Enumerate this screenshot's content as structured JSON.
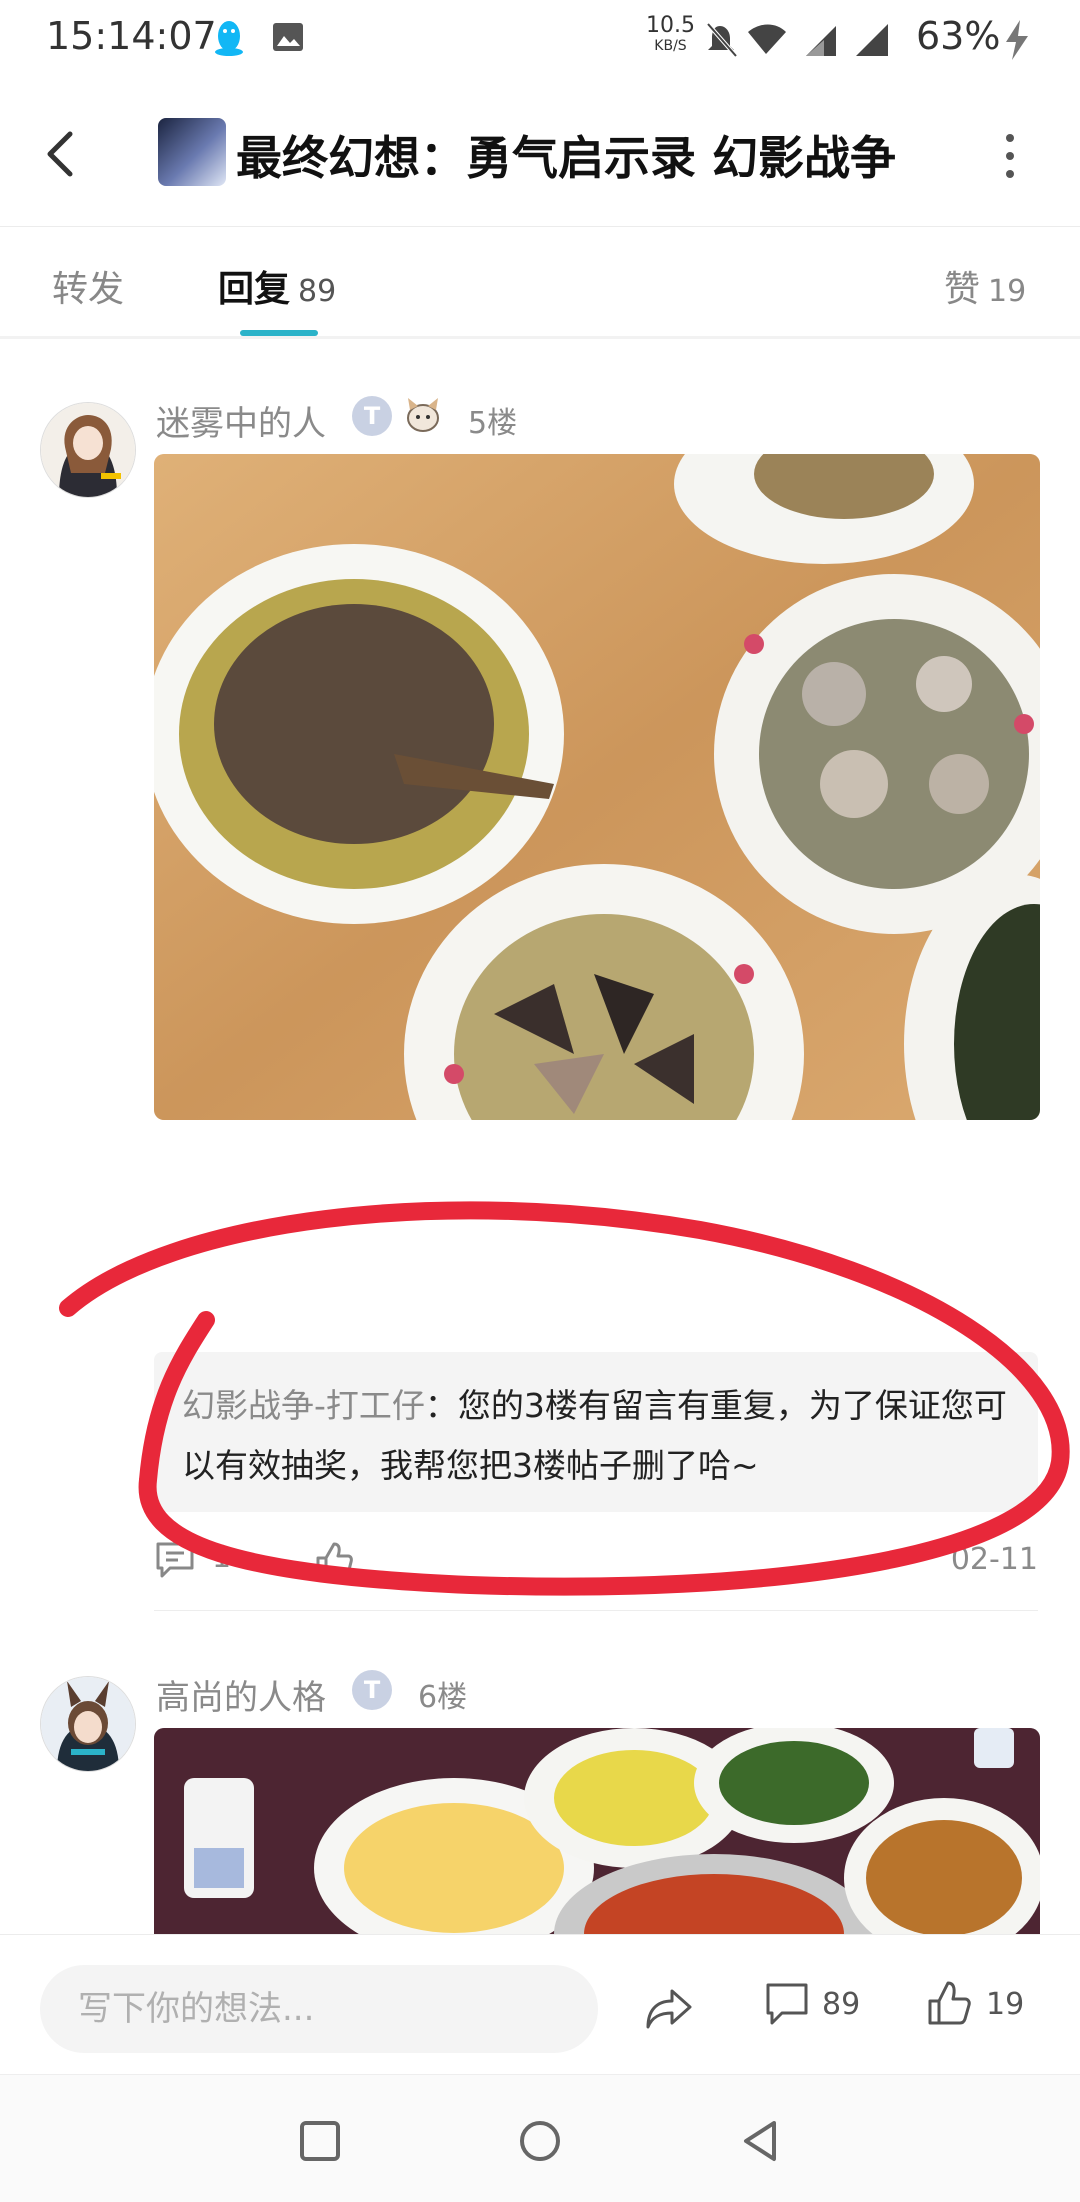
{
  "status_bar": {
    "time": "15:14:07",
    "net_speed": "10.5",
    "net_unit": "KB/S",
    "battery": "63%"
  },
  "header": {
    "title": "最终幻想：勇气启示录 幻影战争"
  },
  "tabs": [
    {
      "label": "转发",
      "count": ""
    },
    {
      "label": "回复",
      "count": "89"
    },
    {
      "label": "赞",
      "count": "19"
    }
  ],
  "posts": [
    {
      "username": "迷雾中的人",
      "level_badge": "T",
      "floor": "5楼",
      "reply": {
        "user": "幻影战争-打工仔",
        "separator": "：",
        "text": "您的3楼有留言有重复，为了保证您可以有效抽奖，我帮您把3楼帖子删了哈~"
      },
      "comment_count": "1",
      "date": "02-11"
    },
    {
      "username": "高尚的人格",
      "level_badge": "T",
      "floor": "6楼"
    }
  ],
  "bottom_bar": {
    "input_placeholder": "写下你的想法...",
    "comment_count": "89",
    "like_count": "19"
  },
  "colors": {
    "accent": "#2bb3c9",
    "annotation_red": "#e8283a"
  },
  "icons": [
    "back-arrow-icon",
    "more-vertical-icon",
    "comment-icon",
    "like-icon",
    "share-icon",
    "square-nav-icon",
    "circle-nav-icon",
    "triangle-back-nav-icon"
  ]
}
